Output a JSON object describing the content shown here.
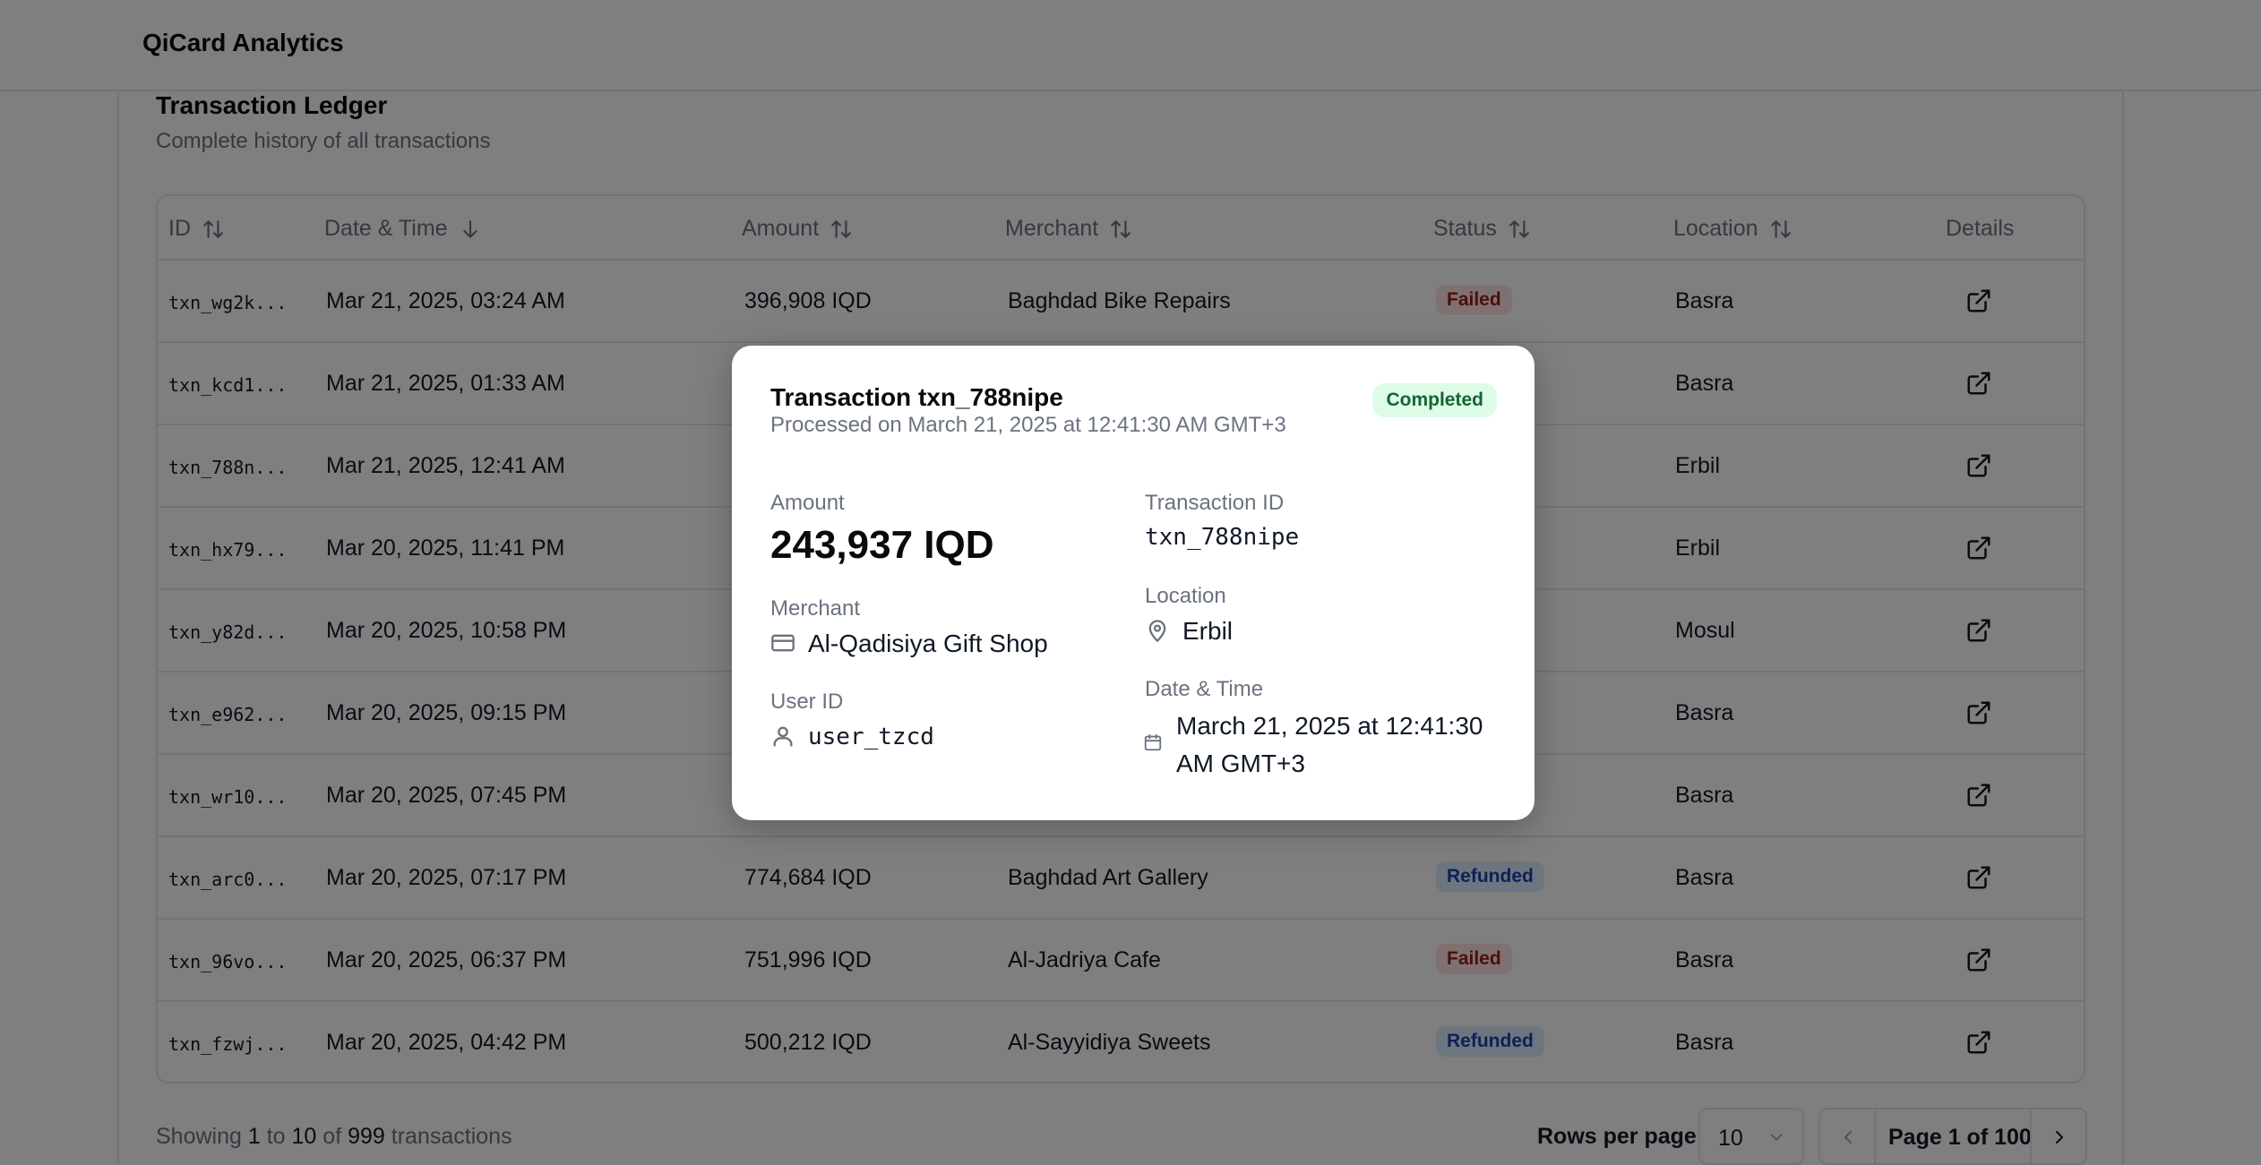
{
  "app": {
    "title": "QiCard Analytics"
  },
  "ledger": {
    "title": "Transaction Ledger",
    "subtitle": "Complete history of all transactions",
    "columns": {
      "id": "ID",
      "datetime": "Date & Time",
      "amount": "Amount",
      "merchant": "Merchant",
      "status": "Status",
      "location": "Location",
      "details": "Details"
    },
    "rows": [
      {
        "id": "txn_wg2k...",
        "datetime": "Mar 21, 2025, 03:24 AM",
        "amount": "396,908 IQD",
        "merchant": "Baghdad Bike Repairs",
        "status": "Failed",
        "status_kind": "failed",
        "location": "Basra"
      },
      {
        "id": "txn_kcd1...",
        "datetime": "Mar 21, 2025, 01:33 AM",
        "amount": "",
        "merchant": "",
        "status": "",
        "status_kind": "",
        "location": "Basra"
      },
      {
        "id": "txn_788n...",
        "datetime": "Mar 21, 2025, 12:41 AM",
        "amount": "",
        "merchant": "",
        "status": "",
        "status_kind": "",
        "location": "Erbil"
      },
      {
        "id": "txn_hx79...",
        "datetime": "Mar 20, 2025, 11:41 PM",
        "amount": "",
        "merchant": "",
        "status": "",
        "status_kind": "",
        "location": "Erbil"
      },
      {
        "id": "txn_y82d...",
        "datetime": "Mar 20, 2025, 10:58 PM",
        "amount": "",
        "merchant": "",
        "status": "",
        "status_kind": "",
        "location": "Mosul"
      },
      {
        "id": "txn_e962...",
        "datetime": "Mar 20, 2025, 09:15 PM",
        "amount": "",
        "merchant": "",
        "status": "",
        "status_kind": "",
        "location": "Basra"
      },
      {
        "id": "txn_wr10...",
        "datetime": "Mar 20, 2025, 07:45 PM",
        "amount": "",
        "merchant": "",
        "status": "",
        "status_kind": "",
        "location": "Basra"
      },
      {
        "id": "txn_arc0...",
        "datetime": "Mar 20, 2025, 07:17 PM",
        "amount": "774,684 IQD",
        "merchant": "Baghdad Art Gallery",
        "status": "Refunded",
        "status_kind": "refunded",
        "location": "Basra"
      },
      {
        "id": "txn_96vo...",
        "datetime": "Mar 20, 2025, 06:37 PM",
        "amount": "751,996 IQD",
        "merchant": "Al-Jadriya Cafe",
        "status": "Failed",
        "status_kind": "failed",
        "location": "Basra"
      },
      {
        "id": "txn_fzwj...",
        "datetime": "Mar 20, 2025, 04:42 PM",
        "amount": "500,212 IQD",
        "merchant": "Al-Sayyidiya Sweets",
        "status": "Refunded",
        "status_kind": "refunded",
        "location": "Basra"
      }
    ]
  },
  "footer": {
    "showing_prefix": "Showing",
    "range_start": "1",
    "to": "to",
    "range_end": "10",
    "of": "of",
    "total": "999",
    "suffix": "transactions",
    "rows_per_page_label": "Rows per page",
    "rows_per_page_value": "10",
    "page_text": "Page 1 of 100"
  },
  "modal": {
    "title": "Transaction txn_788nipe",
    "subtitle": "Processed on March 21, 2025 at 12:41:30 AM GMT+3",
    "status": "Completed",
    "amount_label": "Amount",
    "amount_value": "243,937 IQD",
    "txn_id_label": "Transaction ID",
    "txn_id_value": "txn_788nipe",
    "merchant_label": "Merchant",
    "merchant_value": "Al-Qadisiya Gift Shop",
    "location_label": "Location",
    "location_value": "Erbil",
    "user_label": "User ID",
    "user_value": "user_tzcd",
    "datetime_label": "Date & Time",
    "datetime_value": "March 21, 2025 at 12:41:30 AM GMT+3"
  },
  "icons": {
    "sort": "sort-icon",
    "sort_desc": "arrow-down-icon",
    "details": "external-link-icon",
    "merchant": "credit-card-icon",
    "location": "map-pin-icon",
    "user": "user-icon",
    "datetime": "calendar-icon",
    "chevron_down": "chevron-down-icon",
    "prev": "chevron-left-icon",
    "next": "chevron-right-icon"
  },
  "colors": {
    "failed_bg": "#fee2e2",
    "failed_text": "#991b1b",
    "refunded_bg": "#dbeafe",
    "refunded_text": "#1e40af",
    "completed_bg": "#dcfce7",
    "completed_text": "#166534",
    "overlay": "rgba(0,0,0,0.5)"
  }
}
